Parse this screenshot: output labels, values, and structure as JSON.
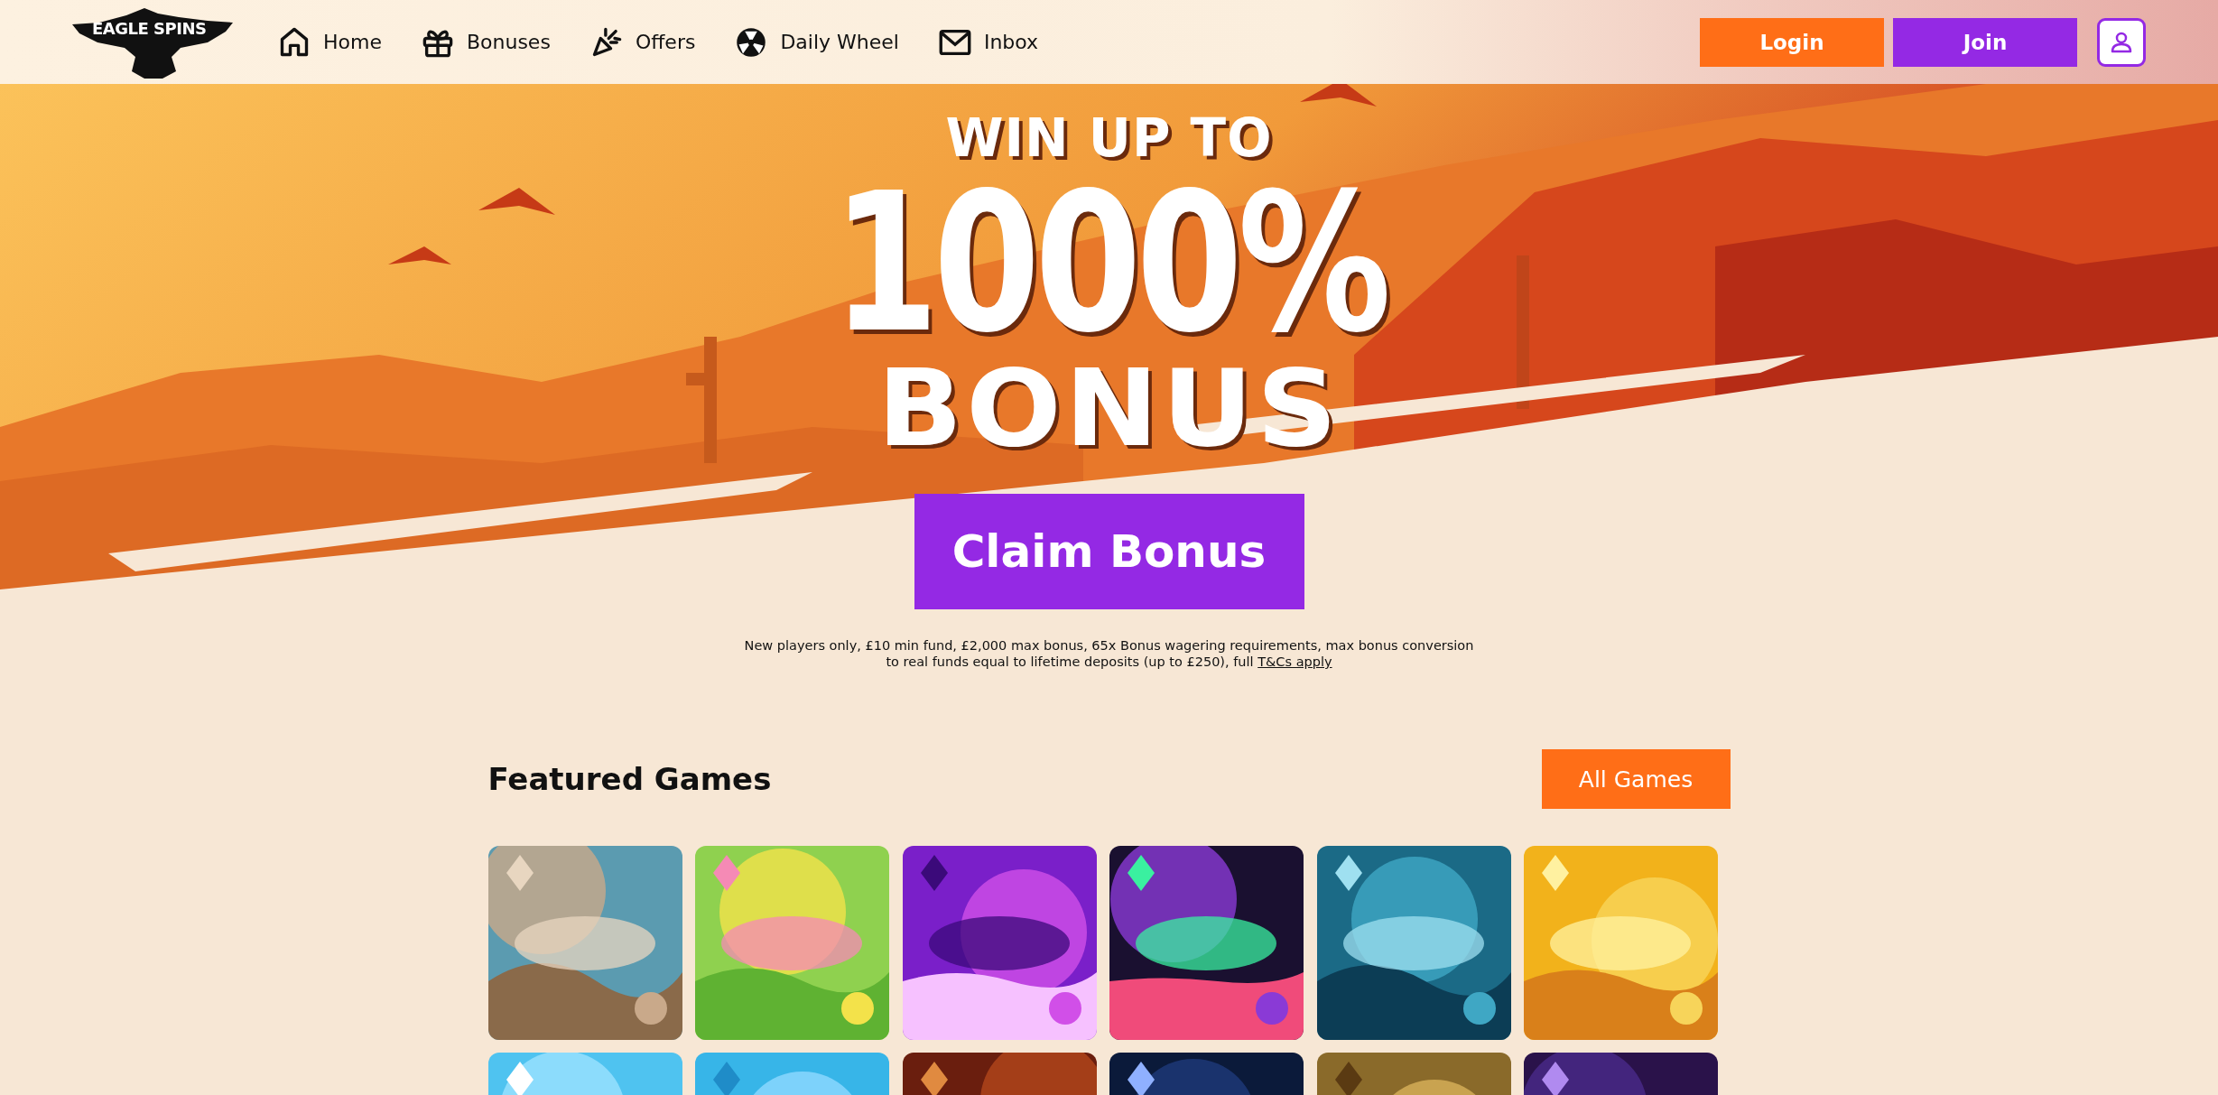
{
  "logo": {
    "text": "EAGLE SPINS"
  },
  "nav": [
    {
      "label": "Home"
    },
    {
      "label": "Bonuses"
    },
    {
      "label": "Offers"
    },
    {
      "label": "Daily Wheel"
    },
    {
      "label": "Inbox"
    }
  ],
  "auth": {
    "login": "Login",
    "join": "Join"
  },
  "hero": {
    "kicker": "WIN UP TO",
    "amount": "1000%",
    "title": "BONUS",
    "cta": "Claim Bonus",
    "terms": "New players only, £10 min fund, £2,000 max bonus, 65x Bonus wagering requirements, max bonus conversion to real funds equal to lifetime deposits (up to £250), full ",
    "terms_link": "T&Cs apply"
  },
  "featured": {
    "title": "Featured Games",
    "button": "All Games"
  }
}
